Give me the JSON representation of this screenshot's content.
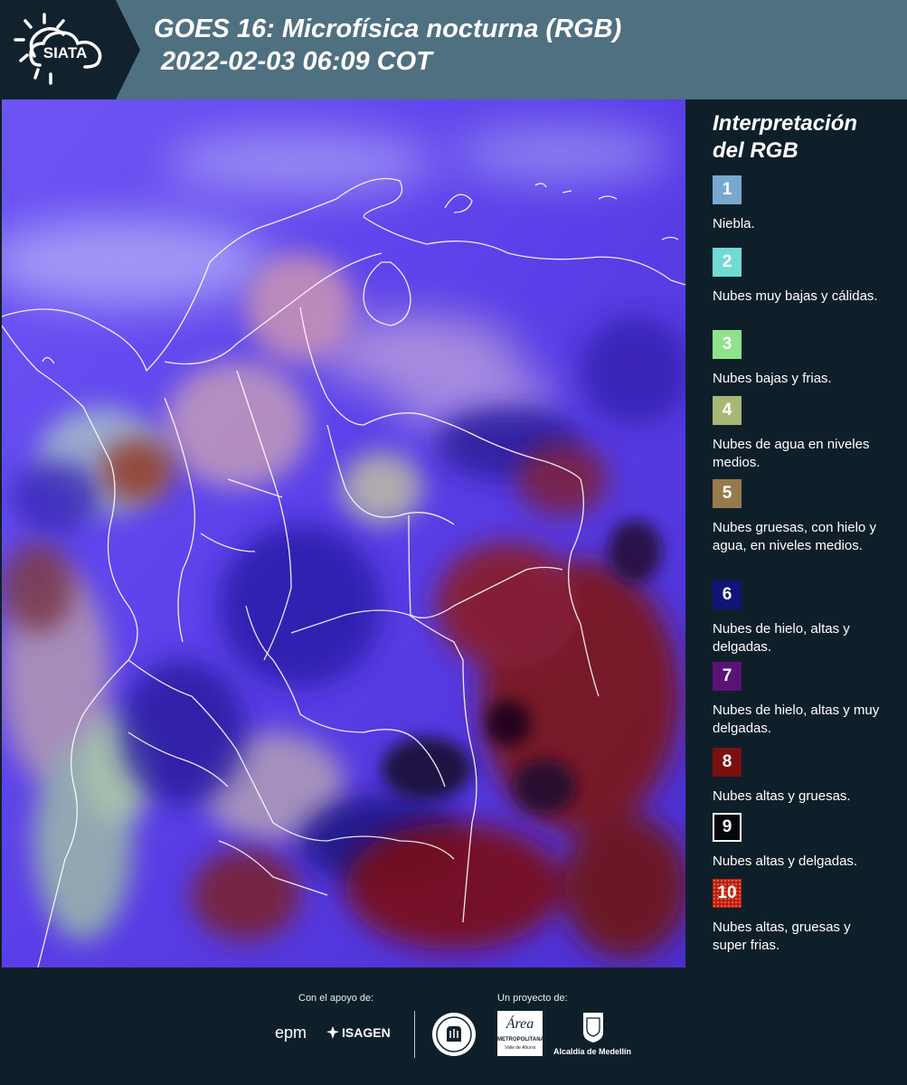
{
  "header": {
    "logo_text": "SIATA",
    "title_line1": "GOES 16: Microfísica nocturna (RGB)",
    "title_line2": " 2022-02-03 06:09 COT"
  },
  "legend": {
    "title_line1": "Interpretación",
    "title_line2": "del RGB",
    "items": [
      {
        "num": "1",
        "color": "#79a8cf",
        "label": "Niebla."
      },
      {
        "num": "2",
        "color": "#6fdbd4",
        "label": "Nubes muy bajas y cálidas."
      },
      {
        "num": "3",
        "color": "#8fe28b",
        "label": "Nubes bajas y frias."
      },
      {
        "num": "4",
        "color": "#a9b776",
        "label": "Nubes de agua en niveles medios."
      },
      {
        "num": "5",
        "color": "#967a4e",
        "label": "Nubes gruesas, con hielo y agua, en niveles medios."
      },
      {
        "num": "6",
        "color": "#0f1478",
        "label": "Nubes de hielo, altas y delgadas."
      },
      {
        "num": "7",
        "color": "#5a1375",
        "label": "Nubes de hielo, altas y muy delgadas."
      },
      {
        "num": "8",
        "color": "#7a1010",
        "label": "Nubes altas y gruesas."
      },
      {
        "num": "9",
        "color": "#05050d",
        "label": "Nubes altas y delgadas."
      },
      {
        "num": "10",
        "color": "#b8190f",
        "label": "Nubes altas, gruesas y super frias."
      }
    ]
  },
  "footer": {
    "support_label": "Con el apoyo de:",
    "project_label": "Un proyecto de:",
    "sponsor1": "epm",
    "sponsor2": "ISAGEN",
    "partner1_line1": "Área",
    "partner1_line2": "METROPOLITANA",
    "partner1_line3": "Valle de Aburrá",
    "partner2": "Alcaldía de Medellín"
  }
}
